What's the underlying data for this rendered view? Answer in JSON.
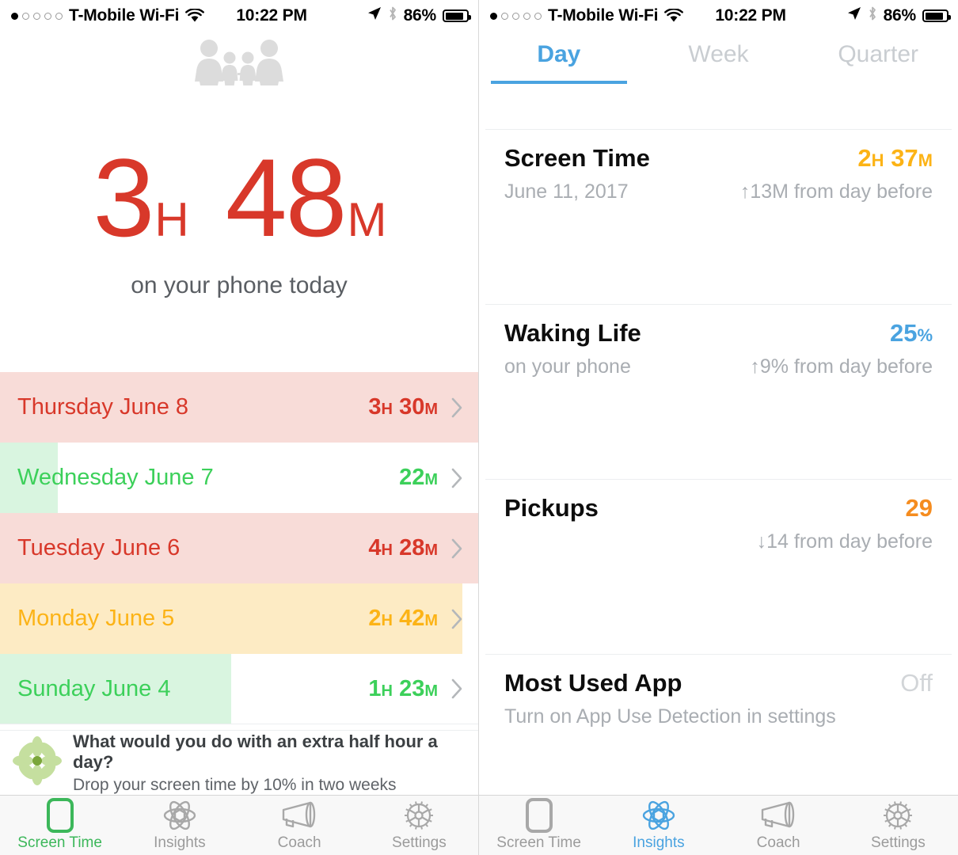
{
  "statusbar": {
    "carrier": "T-Mobile Wi-Fi",
    "time": "10:22 PM",
    "battery_percent": "86%",
    "signal_dots_total": 5,
    "signal_dots_filled": 1,
    "wifi_icon": "wifi-icon",
    "location_icon": "location-arrow-icon",
    "bluetooth_icon": "bluetooth-icon",
    "battery_icon": "battery-icon"
  },
  "left_screen": {
    "header_icon": "family-icon",
    "hero": {
      "hours": "3",
      "hours_unit": "H",
      "minutes": "48",
      "minutes_unit": "M",
      "subtitle": "on your phone today",
      "color": "#d8382a"
    },
    "days": [
      {
        "label": "Thursday June 8",
        "value_hours": "3",
        "value_hours_unit": "H",
        "value_minutes": "30",
        "value_minutes_unit": "M",
        "level": "high",
        "fill_percent": 100,
        "text_color": "#d8382a",
        "fill_color": "#f8dcd8"
      },
      {
        "label": "Wednesday June 7",
        "value_hours": "",
        "value_hours_unit": "",
        "value_minutes": "22",
        "value_minutes_unit": "M",
        "level": "low",
        "fill_percent": 12,
        "text_color": "#3cd05a",
        "fill_color": "#d9f5e0"
      },
      {
        "label": "Tuesday June 6",
        "value_hours": "4",
        "value_hours_unit": "H",
        "value_minutes": "28",
        "value_minutes_unit": "M",
        "level": "high",
        "fill_percent": 100,
        "text_color": "#d8382a",
        "fill_color": "#f8dcd8"
      },
      {
        "label": "Monday June 5",
        "value_hours": "2",
        "value_hours_unit": "H",
        "value_minutes": "42",
        "value_minutes_unit": "M",
        "level": "medium",
        "fill_percent": 96.5,
        "text_color": "#fcb316",
        "fill_color": "#fdebc4"
      },
      {
        "label": "Sunday June 4",
        "value_hours": "1",
        "value_hours_unit": "H",
        "value_minutes": "23",
        "value_minutes_unit": "M",
        "level": "low",
        "fill_percent": 48.3,
        "text_color": "#3cd05a",
        "fill_color": "#d9f5e0"
      }
    ],
    "promo": {
      "icon": "flower-icon",
      "title": "What would you do with an extra half hour a day?",
      "subtitle": "Drop your screen time by 10% in two weeks"
    },
    "tabs": [
      {
        "label": "Screen Time",
        "icon": "phone-icon",
        "active": true
      },
      {
        "label": "Insights",
        "icon": "atom-icon",
        "active": false
      },
      {
        "label": "Coach",
        "icon": "megaphone-icon",
        "active": false
      },
      {
        "label": "Settings",
        "icon": "gear-icon",
        "active": false
      }
    ]
  },
  "right_screen": {
    "segments": [
      {
        "label": "Day",
        "active": true
      },
      {
        "label": "Week",
        "active": false
      },
      {
        "label": "Quarter",
        "active": false
      }
    ],
    "cards": [
      {
        "title": "Screen Time",
        "subtitle": "June 11, 2017",
        "value_main": "2",
        "value_unit1": "H",
        "value_main2": "37",
        "value_unit2": "M",
        "value_color": "#fcb316",
        "delta": "↑13M from day before"
      },
      {
        "title": "Waking Life",
        "subtitle": "on your phone",
        "value_main": "25",
        "value_unit1": "%",
        "value_main2": "",
        "value_unit2": "",
        "value_color": "#4aa3e0",
        "delta": "↑9% from day before"
      },
      {
        "title": "Pickups",
        "subtitle": "",
        "value_main": "29",
        "value_unit1": "",
        "value_main2": "",
        "value_unit2": "",
        "value_color": "#f58c1f",
        "delta": "↓14 from day before"
      },
      {
        "title": "Most Used App",
        "subtitle": "Turn on App Use Detection in settings",
        "value_main": "Off",
        "value_unit1": "",
        "value_main2": "",
        "value_unit2": "",
        "value_color": "#d2d5d8",
        "delta": ""
      }
    ],
    "tabs": [
      {
        "label": "Screen Time",
        "icon": "phone-icon",
        "active": false
      },
      {
        "label": "Insights",
        "icon": "atom-icon",
        "active": true
      },
      {
        "label": "Coach",
        "icon": "megaphone-icon",
        "active": false
      },
      {
        "label": "Settings",
        "icon": "gear-icon",
        "active": false
      }
    ]
  }
}
